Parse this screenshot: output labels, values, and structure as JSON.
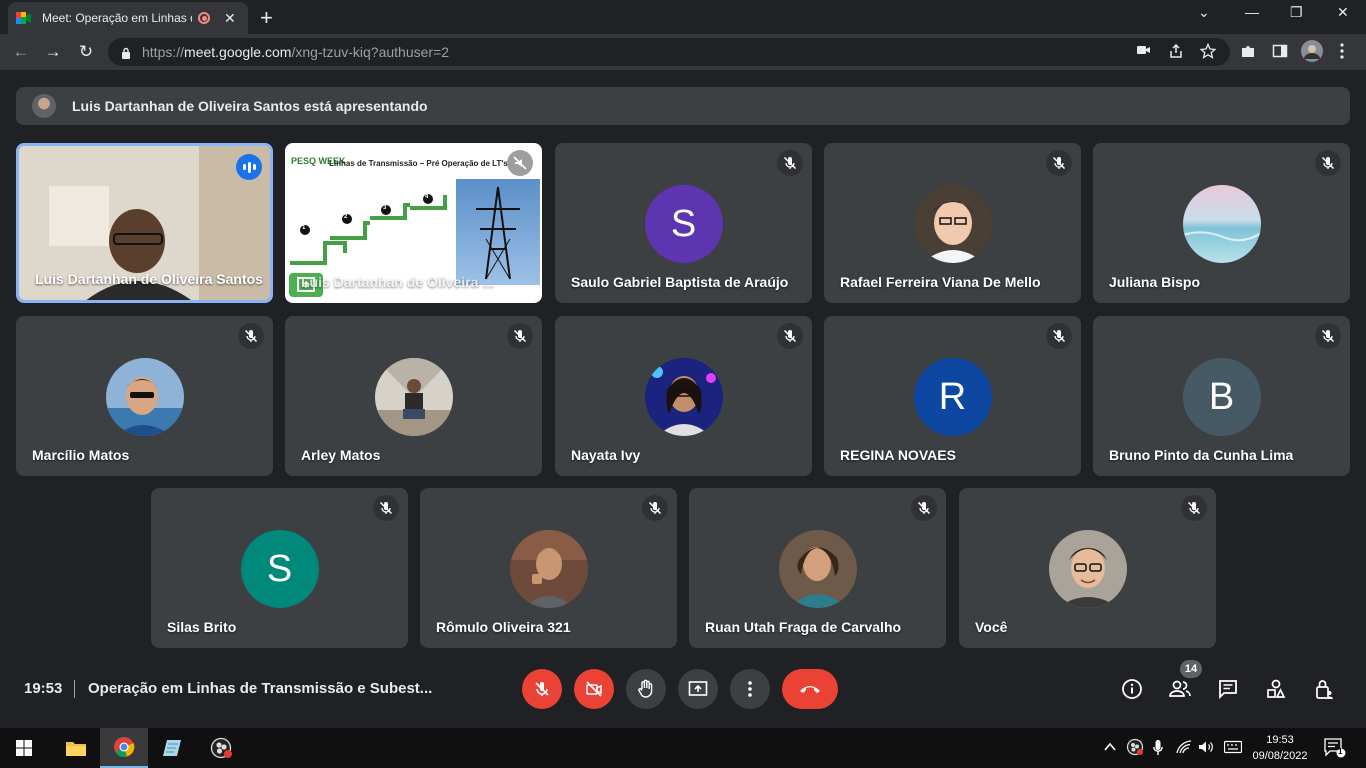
{
  "browser": {
    "tab_title": "Meet: Operação em Linhas de",
    "tab_close": "✕",
    "new_tab": "+",
    "url_host": "meet.google.com",
    "url_path": "/xng-tzuv-kiq?authuser=2",
    "url_scheme": "https://",
    "window_controls": [
      "⌄",
      "—",
      "❐",
      "✕"
    ]
  },
  "banner": {
    "text": "Luis Dartanhan de Oliveira Santos está apresentando"
  },
  "tiles": [
    {
      "name": "Luis Dartanhan de Oliveira Santos",
      "kind": "camera",
      "speaking": true
    },
    {
      "name": "Luis Dartanhan de Oliveira ...",
      "kind": "presentation"
    },
    {
      "name": "Saulo Gabriel Baptista de Araújo",
      "kind": "letter",
      "letter": "S",
      "color": "#5e35b1"
    },
    {
      "name": "Rafael Ferreira Viana De Mello",
      "kind": "photo"
    },
    {
      "name": "Juliana Bispo",
      "kind": "photo"
    },
    {
      "name": "Marcílio Matos",
      "kind": "photo"
    },
    {
      "name": "Arley Matos",
      "kind": "photo"
    },
    {
      "name": "Nayata Ivy",
      "kind": "photo"
    },
    {
      "name": "REGINA NOVAES",
      "kind": "letter",
      "letter": "R",
      "color": "#0d47a1"
    },
    {
      "name": "Bruno Pinto da Cunha Lima",
      "kind": "letter",
      "letter": "B",
      "color": "#455a64"
    },
    {
      "name": "Silas Brito",
      "kind": "letter",
      "letter": "S",
      "color": "#00897b"
    },
    {
      "name": "Rômulo Oliveira 321",
      "kind": "photo"
    },
    {
      "name": "Ruan Utah Fraga de Carvalho",
      "kind": "photo"
    },
    {
      "name": "Você",
      "kind": "photo"
    }
  ],
  "slide": {
    "title": "Linhas de Transmissão – Pré Operação de LT's",
    "logo": "PESQ WEEK",
    "steps": [
      "1",
      "2",
      "3",
      "4"
    ]
  },
  "meeting": {
    "time": "19:53",
    "name": "Operação em Linhas de Transmissão e Subest...",
    "participants_count": "14"
  },
  "taskbar": {
    "time": "19:53",
    "date": "09/08/2022",
    "notifications": "1"
  },
  "colors": {
    "accent": "#8ab4f8",
    "danger": "#ea4335",
    "tile_bg": "#3c4043",
    "page_bg": "#202124"
  }
}
